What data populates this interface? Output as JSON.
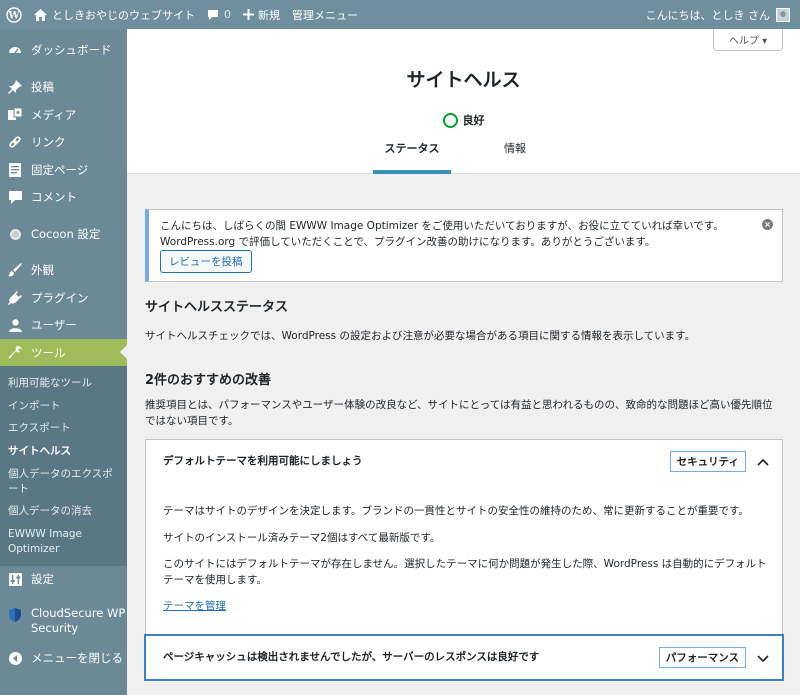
{
  "admin_bar": {
    "site_name": "としきおやじのウェブサイト",
    "comments_count": "0",
    "new_label": "新規",
    "admin_menu_label": "管理メニュー",
    "greeting": "こんにちは、としき さん"
  },
  "sidebar": {
    "items": [
      {
        "label": "ダッシュボード",
        "icon": "dashboard-icon"
      },
      {
        "label": "投稿",
        "icon": "pin-icon"
      },
      {
        "label": "メディア",
        "icon": "media-icon"
      },
      {
        "label": "リンク",
        "icon": "link-icon"
      },
      {
        "label": "固定ページ",
        "icon": "page-icon"
      },
      {
        "label": "コメント",
        "icon": "comment-icon"
      },
      {
        "label": "Cocoon 設定",
        "icon": "cocoon-icon"
      },
      {
        "label": "外観",
        "icon": "brush-icon"
      },
      {
        "label": "プラグイン",
        "icon": "plugin-icon"
      },
      {
        "label": "ユーザー",
        "icon": "user-icon"
      },
      {
        "label": "ツール",
        "icon": "wrench-icon"
      },
      {
        "label": "設定",
        "icon": "settings-icon"
      },
      {
        "label": "CloudSecure WP Security",
        "icon": "shield-icon"
      },
      {
        "label": "メニューを閉じる",
        "icon": "collapse-icon"
      }
    ],
    "submenu": [
      "利用可能なツール",
      "インポート",
      "エクスポート",
      "サイトヘルス",
      "個人データのエクスポート",
      "個人データの消去",
      "EWWW Image Optimizer"
    ]
  },
  "header": {
    "help_label": "ヘルプ ▾",
    "title": "サイトヘルス",
    "status": "良好",
    "tabs": [
      "ステータス",
      "情報"
    ]
  },
  "notice": {
    "line1": "こんにちは、しばらくの間 EWWW Image Optimizer をご使用いただいておりますが、お役に立てていれば幸いです。",
    "line2": "WordPress.org で評価していただくことで、プラグイン改善の助けになります。ありがとうございます。",
    "button": "レビューを投稿"
  },
  "main": {
    "status_heading": "サイトヘルスステータス",
    "status_desc": "サイトヘルスチェックでは、WordPress の設定および注意が必要な場合がある項目に関する情報を表示しています。",
    "improvements_heading": "2件のおすすめの改善",
    "improvements_desc_1": "推奨項目とは、パフォーマンスやユーザー体験の改良など、サイトにとっては有益と思われるものの、致命的な問題ほど高い優先順位",
    "improvements_desc_2": "ではない項目です。"
  },
  "accordion": [
    {
      "title": "デフォルトテーマを利用可能にしましょう",
      "badge": "セキュリティ",
      "expanded": true,
      "p1": "テーマはサイトのデザインを決定します。ブランドの一貫性とサイトの安全性の維持のため、常に更新することが重要です。",
      "p2": "サイトのインストール済みテーマ2個はすべて最新版です。",
      "p3a": "このサイトにはデフォルトテーマが存在しません。選択したテーマに何か問題が発生した際、WordPress は自動的にデフォルト",
      "p3b": "テーマを使用します。",
      "link": "テーマを管理"
    },
    {
      "title": "ページキャッシュは検出されませんでしたが、サーバーのレスポンスは良好です",
      "badge": "パフォーマンス",
      "expanded": false
    }
  ],
  "colors": {
    "admin_bar": "#6f8f9f",
    "sidebar": "#6b8996",
    "submenu": "#5a7785",
    "active_menu": "#9ebd5a",
    "good_status": "#00a32a",
    "link": "#2271b1",
    "badge_border": "#72aee6"
  }
}
